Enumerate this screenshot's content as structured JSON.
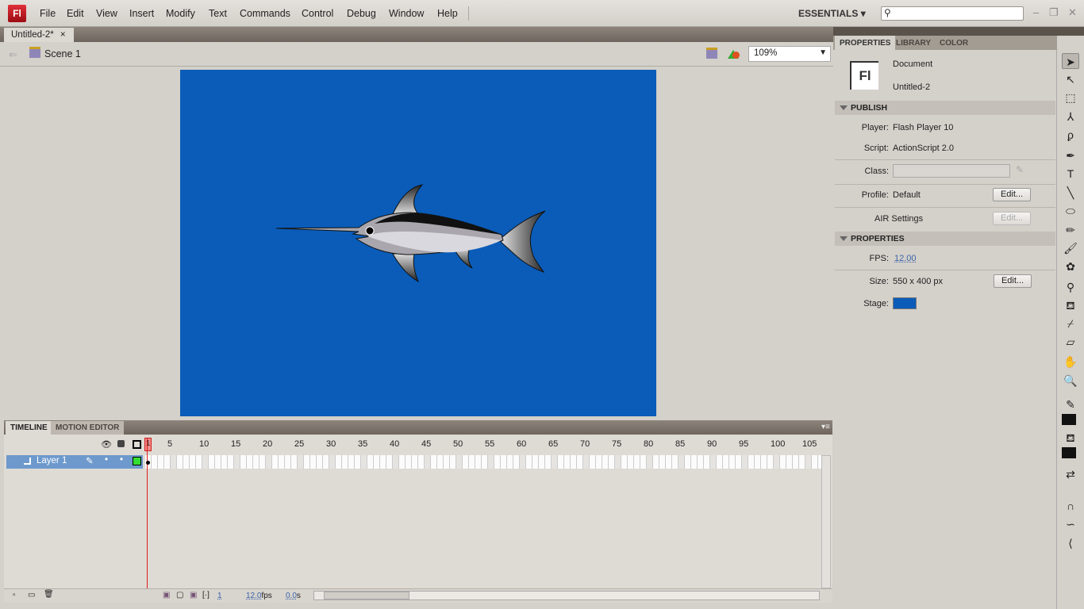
{
  "app": {
    "logo": "Fl",
    "workspace": "ESSENTIALS",
    "search_placeholder": ""
  },
  "menu": [
    "File",
    "Edit",
    "View",
    "Insert",
    "Modify",
    "Text",
    "Commands",
    "Control",
    "Debug",
    "Window",
    "Help"
  ],
  "doc_tab": {
    "label": "Untitled-2*",
    "close": "×"
  },
  "scene": {
    "label": "Scene 1",
    "zoom": "109%"
  },
  "stage": {
    "color": "#0a5cb8"
  },
  "timeline": {
    "tabs": [
      "TIMELINE",
      "MOTION EDITOR"
    ],
    "frame_labels": [
      1,
      5,
      10,
      15,
      20,
      25,
      30,
      35,
      40,
      45,
      50,
      55,
      60,
      65,
      70,
      75,
      80,
      85,
      90,
      95,
      100,
      105
    ],
    "layer": "Layer 1",
    "current_frame": "1",
    "fps": "12.0",
    "fps_unit": "fps",
    "time": "0.0",
    "time_unit": "s",
    "layer_color": "#33dd33"
  },
  "panel": {
    "tabs": [
      "PROPERTIES",
      "LIBRARY",
      "COLOR"
    ],
    "doc_type": "Document",
    "doc_name": "Untitled-2",
    "publish": {
      "title": "PUBLISH",
      "player_label": "Player:",
      "player": "Flash Player 10",
      "script_label": "Script:",
      "script": "ActionScript 2.0",
      "class_label": "Class:",
      "class_value": "",
      "profile_label": "Profile:",
      "profile": "Default",
      "air": "AIR Settings",
      "edit": "Edit..."
    },
    "properties": {
      "title": "PROPERTIES",
      "fps_label": "FPS:",
      "fps": "12.00",
      "size_label": "Size:",
      "size": "550 x 400 px",
      "stage_label": "Stage:",
      "stage_color": "#0a5cb8"
    }
  },
  "tools": [
    "selection",
    "subselection",
    "free-transform",
    "3d-rotation",
    "lasso",
    "pen",
    "text",
    "line",
    "oval",
    "pencil",
    "brush",
    "deco",
    "bone",
    "paint-bucket",
    "eyedropper",
    "eraser",
    "hand",
    "zoom",
    "stroke-color",
    "fill-color",
    "swap-colors",
    "snap",
    "smooth",
    "straighten"
  ]
}
